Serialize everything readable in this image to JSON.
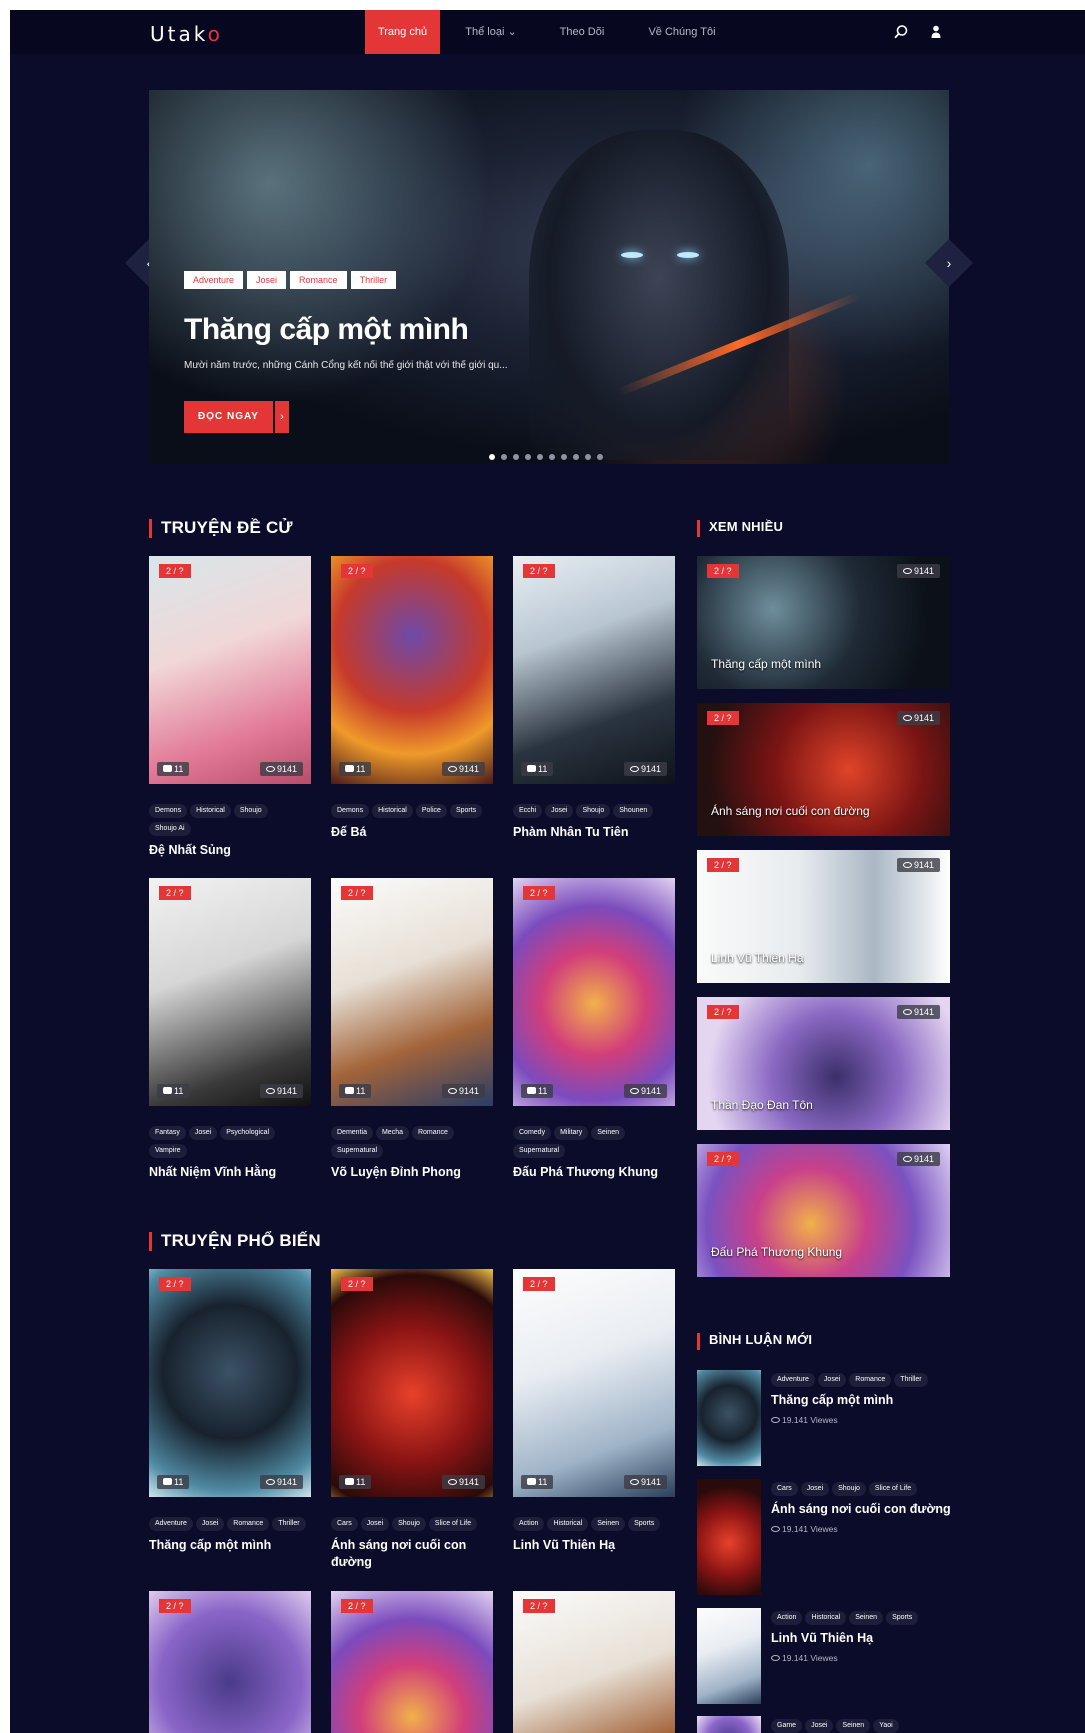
{
  "header": {
    "logo_main": "Utak",
    "logo_accent": "o",
    "nav": [
      {
        "label": "Trang chủ",
        "active": true
      },
      {
        "label": "Thể loại ⌄",
        "active": false
      },
      {
        "label": "Theo Dõi",
        "active": false
      },
      {
        "label": "Về Chúng Tôi",
        "active": false
      }
    ],
    "icons": [
      "search-icon",
      "user-icon"
    ]
  },
  "hero": {
    "tags": [
      "Adventure",
      "Josei",
      "Romance",
      "Thriller"
    ],
    "title": "Thăng cấp một mình",
    "description": "Mười năm trước, những Cánh Cổng kết nối thế giới thật với thế giới qu...",
    "button_label": "ĐỌC NGAY",
    "button_arrow": "›",
    "prev_arrow": "‹",
    "next_arrow": "›",
    "dots_total": 10,
    "dot_active": 0
  },
  "sections": {
    "recommended": "TRUYỆN ĐỀ CỬ",
    "popular": "TRUYỆN PHỔ BIẾN",
    "most_viewed": "XEM NHIỀU",
    "new_comments": "BÌNH LUẬN MỚI"
  },
  "recommended": [
    {
      "ep": "2 / ?",
      "comments": "11",
      "views": "9141",
      "tags": [
        "Demons",
        "Historical",
        "Shoujo",
        "Shoujo Ai"
      ],
      "title": "Đệ Nhất Sủng"
    },
    {
      "ep": "2 / ?",
      "comments": "11",
      "views": "9141",
      "tags": [
        "Demons",
        "Historical",
        "Police",
        "Sports"
      ],
      "title": "Đế Bá"
    },
    {
      "ep": "2 / ?",
      "comments": "11",
      "views": "9141",
      "tags": [
        "Ecchi",
        "Josei",
        "Shoujo",
        "Shounen"
      ],
      "title": "Phàm Nhân Tu Tiên"
    },
    {
      "ep": "2 / ?",
      "comments": "11",
      "views": "9141",
      "tags": [
        "Fantasy",
        "Josei",
        "Psychological",
        "Vampire"
      ],
      "title": "Nhất Niệm Vĩnh Hằng"
    },
    {
      "ep": "2 / ?",
      "comments": "11",
      "views": "9141",
      "tags": [
        "Dementia",
        "Mecha",
        "Romance",
        "Supernatural"
      ],
      "title": "Võ Luyện Đỉnh Phong"
    },
    {
      "ep": "2 / ?",
      "comments": "11",
      "views": "9141",
      "tags": [
        "Comedy",
        "Military",
        "Seinen",
        "Supernatural"
      ],
      "title": "Đấu Phá Thương Khung"
    }
  ],
  "popular": [
    {
      "ep": "2 / ?",
      "comments": "11",
      "views": "9141",
      "tags": [
        "Adventure",
        "Josei",
        "Romance",
        "Thriller"
      ],
      "title": "Thăng cấp một mình"
    },
    {
      "ep": "2 / ?",
      "comments": "11",
      "views": "9141",
      "tags": [
        "Cars",
        "Josei",
        "Shoujo",
        "Slice of Life"
      ],
      "title": "Ánh sáng nơi cuối con đường"
    },
    {
      "ep": "2 / ?",
      "comments": "11",
      "views": "9141",
      "tags": [
        "Action",
        "Historical",
        "Seinen",
        "Sports"
      ],
      "title": "Linh Vũ Thiên Hạ"
    },
    {
      "ep": "2 / ?"
    },
    {
      "ep": "2 / ?"
    },
    {
      "ep": "2 / ?"
    }
  ],
  "most_viewed": [
    {
      "ep": "2 / ?",
      "views": "9141",
      "title": "Thăng cấp một mình"
    },
    {
      "ep": "2 / ?",
      "views": "9141",
      "title": "Ánh sáng nơi cuối con đường"
    },
    {
      "ep": "2 / ?",
      "views": "9141",
      "title": "Linh Vũ Thiên Hạ"
    },
    {
      "ep": "2 / ?",
      "views": "9141",
      "title": "Thần Đạo Đan Tôn"
    },
    {
      "ep": "2 / ?",
      "views": "9141",
      "title": "Đấu Phá Thương Khung"
    }
  ],
  "new_comments": [
    {
      "tags": [
        "Adventure",
        "Josei",
        "Romance",
        "Thriller"
      ],
      "title": "Thăng cấp một mình",
      "views": "19.141 Viewes"
    },
    {
      "tags": [
        "Cars",
        "Josei",
        "Shoujo",
        "Slice of Life"
      ],
      "title": "Ánh sáng nơi cuối con đường",
      "views": "19.141 Viewes"
    },
    {
      "tags": [
        "Action",
        "Historical",
        "Seinen",
        "Sports"
      ],
      "title": "Linh Vũ Thiên Hạ",
      "views": "19.141 Viewes"
    },
    {
      "tags": [
        "Game",
        "Josei",
        "Seinen",
        "Yaoi"
      ]
    }
  ],
  "colors": {
    "accent": "#e53637",
    "background": "#0b0c2a",
    "header": "#070720"
  }
}
